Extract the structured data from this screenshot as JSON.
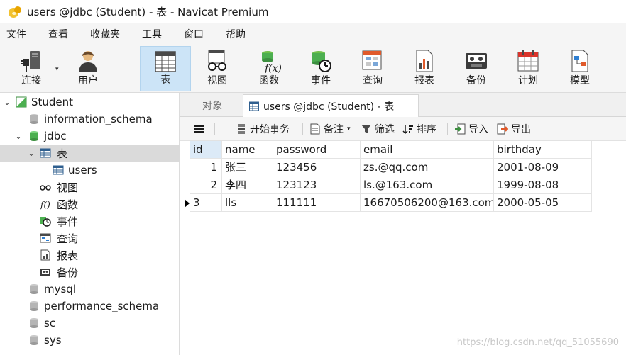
{
  "window": {
    "title": "users @jdbc (Student) - 表 - Navicat Premium"
  },
  "menu": [
    "文件",
    "查看",
    "收藏夹",
    "工具",
    "窗口",
    "帮助"
  ],
  "toolbar": {
    "buttons": [
      {
        "label": "连接",
        "icon": "plug-icon"
      },
      {
        "label": "用户",
        "icon": "user-icon"
      },
      {
        "label": "表",
        "icon": "table-icon"
      },
      {
        "label": "视图",
        "icon": "view-glasses-icon"
      },
      {
        "label": "函数",
        "icon": "function-icon"
      },
      {
        "label": "事件",
        "icon": "event-clock-icon"
      },
      {
        "label": "查询",
        "icon": "query-icon"
      },
      {
        "label": "报表",
        "icon": "report-icon"
      },
      {
        "label": "备份",
        "icon": "backup-icon"
      },
      {
        "label": "计划",
        "icon": "calendar-icon"
      },
      {
        "label": "模型",
        "icon": "model-icon"
      }
    ]
  },
  "tree": {
    "connection": "Student",
    "databases": {
      "information_schema": "information_schema",
      "jdbc": "jdbc",
      "mysql": "mysql",
      "performance_schema": "performance_schema",
      "sc": "sc",
      "sys": "sys"
    },
    "jdbc_children": {
      "tables": "表",
      "users": "users",
      "views": "视图",
      "functions": "函数",
      "events": "事件",
      "queries": "查询",
      "reports": "报表",
      "backups": "备份"
    }
  },
  "tabs": {
    "objects": "对象",
    "main": "users @jdbc (Student) - 表"
  },
  "table_toolbar": {
    "begin_transaction": "开始事务",
    "comment": "备注",
    "filter": "筛选",
    "sort": "排序",
    "import": "导入",
    "export": "导出"
  },
  "grid": {
    "columns": [
      "id",
      "name",
      "password",
      "email",
      "birthday"
    ],
    "rows": [
      [
        "1",
        "张三",
        "123456",
        "zs.@qq.com",
        "2001-08-09"
      ],
      [
        "2",
        "李四",
        "123123",
        "ls.@163.com",
        "1999-08-08"
      ],
      [
        "3",
        "lls",
        "111111",
        "16670506200@163.com",
        "2000-05-05"
      ]
    ]
  },
  "watermark": "https://blog.csdn.net/qq_51055690",
  "colors": {
    "selected_tab": "#cce4f7",
    "tree_selected": "#dadada",
    "db_icon_green": "#4caf50",
    "db_icon_gray": "#b5b5b5"
  }
}
